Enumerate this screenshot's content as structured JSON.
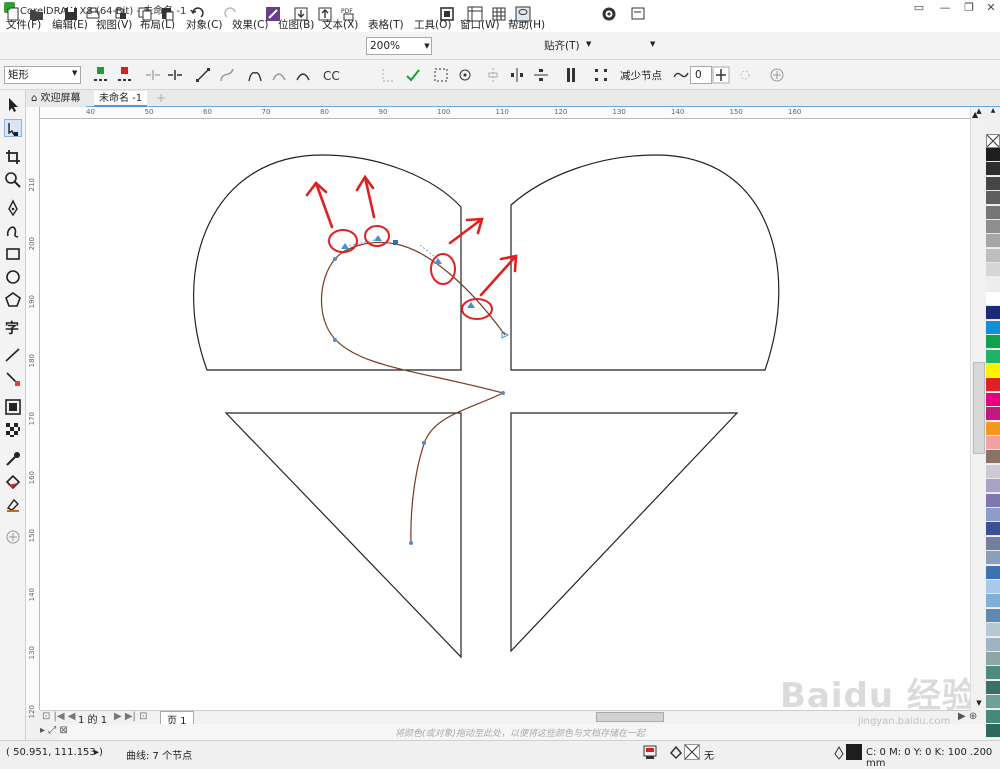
{
  "app_title": "CorelDRAW X8 (64-Bit) - 未命名 -1",
  "menu": [
    "文件(F)",
    "编辑(E)",
    "视图(V)",
    "布局(L)",
    "对象(C)",
    "效果(C)",
    "位图(B)",
    "文本(X)",
    "表格(T)",
    "工具(O)",
    "窗口(W)",
    "帮助(H)"
  ],
  "toolbar": {
    "zoom": "200%",
    "snap_label": "贴齐(T)"
  },
  "propbar": {
    "object_type": "矩形",
    "reduce_nodes_label": "减少节点",
    "smoothness": "0"
  },
  "tabs": {
    "welcome": "欢迎屏幕",
    "document": "未命名 -1"
  },
  "rulers": {
    "h_labels": [
      "40",
      "50",
      "60",
      "70",
      "80",
      "90",
      "100",
      "110",
      "120",
      "130",
      "140",
      "150",
      "160"
    ],
    "v_labels": [
      "210",
      "200",
      "190",
      "180",
      "170",
      "160",
      "150",
      "140",
      "130",
      "120"
    ]
  },
  "pagebar": {
    "page_info": "1 的 1",
    "page_tab": "页 1"
  },
  "hint": "将颜色(或对象)拖动至此处，以便将这些颜色与文档存储在一起",
  "status": {
    "coords": "( 50.951, 111.153 )",
    "selection": "曲线: 7 个节点",
    "fill_none": "无",
    "outline_info": "C: 0 M: 0 Y: 0 K: 100  .200 mm"
  },
  "watermark": {
    "logo": "Baidu 经验",
    "url": "jingyan.baidu.com"
  },
  "palette_colors": [
    "#1e1e1e",
    "#2e2e2e",
    "#464646",
    "#5e5e5e",
    "#767676",
    "#8e8e8e",
    "#a6a6a6",
    "#bebebe",
    "#d6d6d6",
    "#ededed",
    "#ffffff",
    "#1d2a7a",
    "#0f8fd6",
    "#12a14b",
    "#1fb26a",
    "#fff200",
    "#e31e24",
    "#e4007f",
    "#c2187f",
    "#f39a1e",
    "#efa2a0",
    "#8a7268",
    "#cfc9d6",
    "#a7a2c6",
    "#7d78b0",
    "#8f9bc8",
    "#3c4e94",
    "#737fa0",
    "#8aa0b8",
    "#3e72b3",
    "#a6cae8",
    "#7fb1d8",
    "#5d8ab0",
    "#b8c9d4",
    "#9fb3c0",
    "#8ea7a3",
    "#4f8a7e",
    "#3c6f68",
    "#6fa297",
    "#45897a",
    "#2d6a5c"
  ],
  "icons": [
    "pick-tool",
    "shape-tool",
    "crop-tool",
    "zoom-tool",
    "freehand-tool",
    "artistic-media-tool",
    "rectangle-tool",
    "ellipse-tool",
    "polygon-tool",
    "text-tool",
    "parallel-dimension-tool",
    "connector-tool",
    "drop-shadow-tool",
    "transparency-tool",
    "eyedropper-tool",
    "interactive-fill-tool",
    "smart-fill-tool"
  ]
}
